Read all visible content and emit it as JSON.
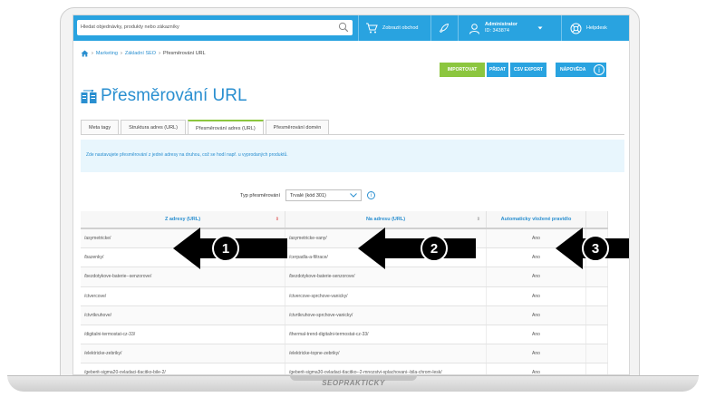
{
  "topbar": {
    "search_placeholder": "Hledat objednávky, produkty nebo zákazníky",
    "view_store": "Zobrazit obchod",
    "user_name": "Administrator",
    "user_id": "ID: 343874",
    "help": "Helpdesk"
  },
  "breadcrumb": {
    "items": [
      "Marketing",
      "Základní SEO",
      "Přesměrování URL"
    ]
  },
  "actions": {
    "import": "IMPORTOVAT",
    "add": "PŘIDAT",
    "csv_export": "CSV EXPORT",
    "help": "NÁPOVĚDA"
  },
  "page": {
    "title": "Přesměrování URL"
  },
  "tabs": [
    {
      "label": "Meta tagy"
    },
    {
      "label": "Struktura adres (URL)"
    },
    {
      "label": "Přesměrování adres (URL)"
    },
    {
      "label": "Přesměrování domén"
    }
  ],
  "info_text": "Zde nastavujete přesměrování z jedné adresy na druhou, což se hodí např. u vyprodaných produktů.",
  "redirect_type": {
    "label": "Typ přesměrování",
    "value": "Trvalé (kód 301)"
  },
  "table": {
    "headers": [
      "Z adresy (URL)",
      "Na adresu (URL)",
      "Automaticky vložené pravidlo"
    ],
    "rows": [
      [
        "/asymetricke/",
        "/asymetricke-vany/",
        "Ano"
      ],
      [
        "/bazenky/",
        "/cerpadla-a-filtrace/",
        "Ano"
      ],
      [
        "/bezdotykove-baterie--senzorove/",
        "/bezdotykove-baterie-senzorove/",
        "Ano"
      ],
      [
        "/ctvercove/",
        "/ctvercove-sprchove-vanicky/",
        "Ano"
      ],
      [
        "/ctvrtkruhove/",
        "/ctvrtkruhove-sprchove-vanicky/",
        "Ano"
      ],
      [
        "/digitalni-termostat-cz-33/",
        "/thermal-trend-digitalni-termostat-cz-33/",
        "Ano"
      ],
      [
        "/elektricke-zebriky/",
        "/elektricke-topne-zebriky/",
        "Ano"
      ],
      [
        "/geberit-sigma20-ovladaci-tlacitko-bile-2/",
        "/geberit-sigma30-ovladaci-tlacitko--2-mnozstvi-splachovani--bila-chrom-lesk/",
        "Ano"
      ]
    ]
  },
  "callouts": [
    "1",
    "2",
    "3"
  ],
  "base_logo": "SEOPRAKTICKY",
  "colors": {
    "accent": "#29a3e0",
    "green": "#8cc63f"
  }
}
